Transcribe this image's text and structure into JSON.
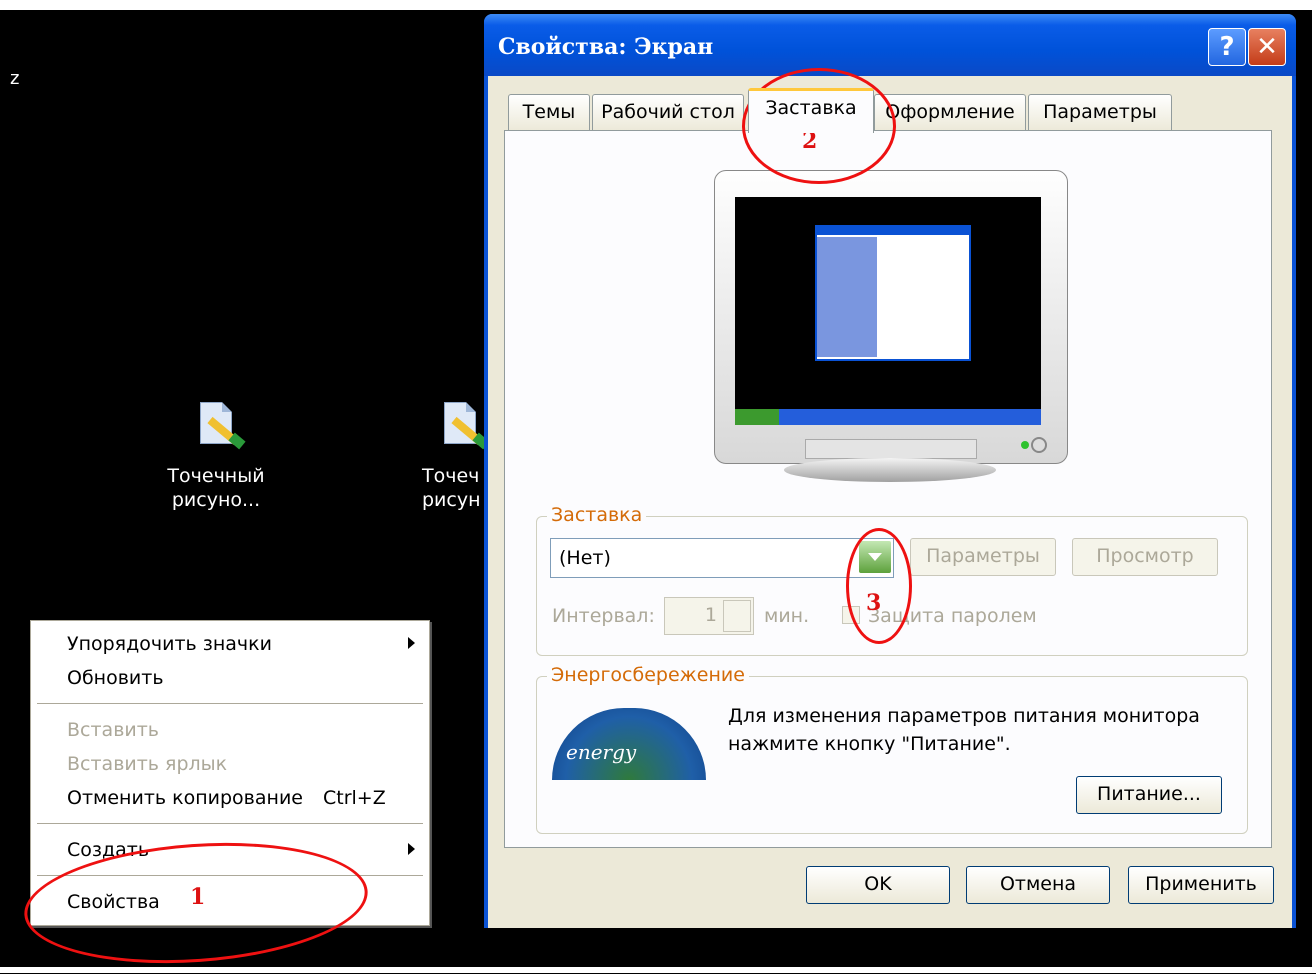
{
  "desktop": {
    "stray_char": "z",
    "icons": [
      {
        "label": "Точечный рисуно...",
        "icon": "paint-document-icon"
      },
      {
        "label": "Точеч рисун",
        "icon": "paint-document-icon"
      }
    ]
  },
  "context_menu": {
    "items": [
      {
        "label": "Упорядочить значки",
        "submenu": true,
        "disabled": false
      },
      {
        "label": "Обновить",
        "disabled": false
      },
      {
        "label": "Вставить",
        "disabled": true
      },
      {
        "label": "Вставить ярлык",
        "disabled": true
      },
      {
        "label": "Отменить копирование",
        "shortcut": "Ctrl+Z",
        "disabled": false
      },
      {
        "label": "Создать",
        "submenu": true,
        "disabled": false
      },
      {
        "label": "Свойства",
        "disabled": false
      }
    ]
  },
  "dialog": {
    "title": "Свойства: Экран",
    "help_label": "?",
    "close_label": "✕",
    "tabs": [
      "Темы",
      "Рабочий стол",
      "Заставка",
      "Оформление",
      "Параметры"
    ],
    "active_tab": "Заставка",
    "screensaver": {
      "group_label": "Заставка",
      "selected": "(Нет)",
      "settings_button": "Параметры",
      "preview_button": "Просмотр",
      "interval_label": "Интервал:",
      "interval_value": "1",
      "interval_unit": "мин.",
      "password_label": "Защита паролем"
    },
    "power": {
      "group_label": "Энергосбережение",
      "text_line1": "Для изменения параметров питания монитора",
      "text_line2": "нажмите кнопку \"Питание\".",
      "button": "Питание...",
      "logo_text": "energy"
    },
    "buttons": {
      "ok": "OK",
      "cancel": "Отмена",
      "apply": "Применить"
    }
  },
  "annotations": [
    "1",
    "2",
    "3"
  ],
  "colors": {
    "annotation": "#e11111",
    "title_bar": "#0052d9",
    "dialog_face": "#ece9d8"
  }
}
